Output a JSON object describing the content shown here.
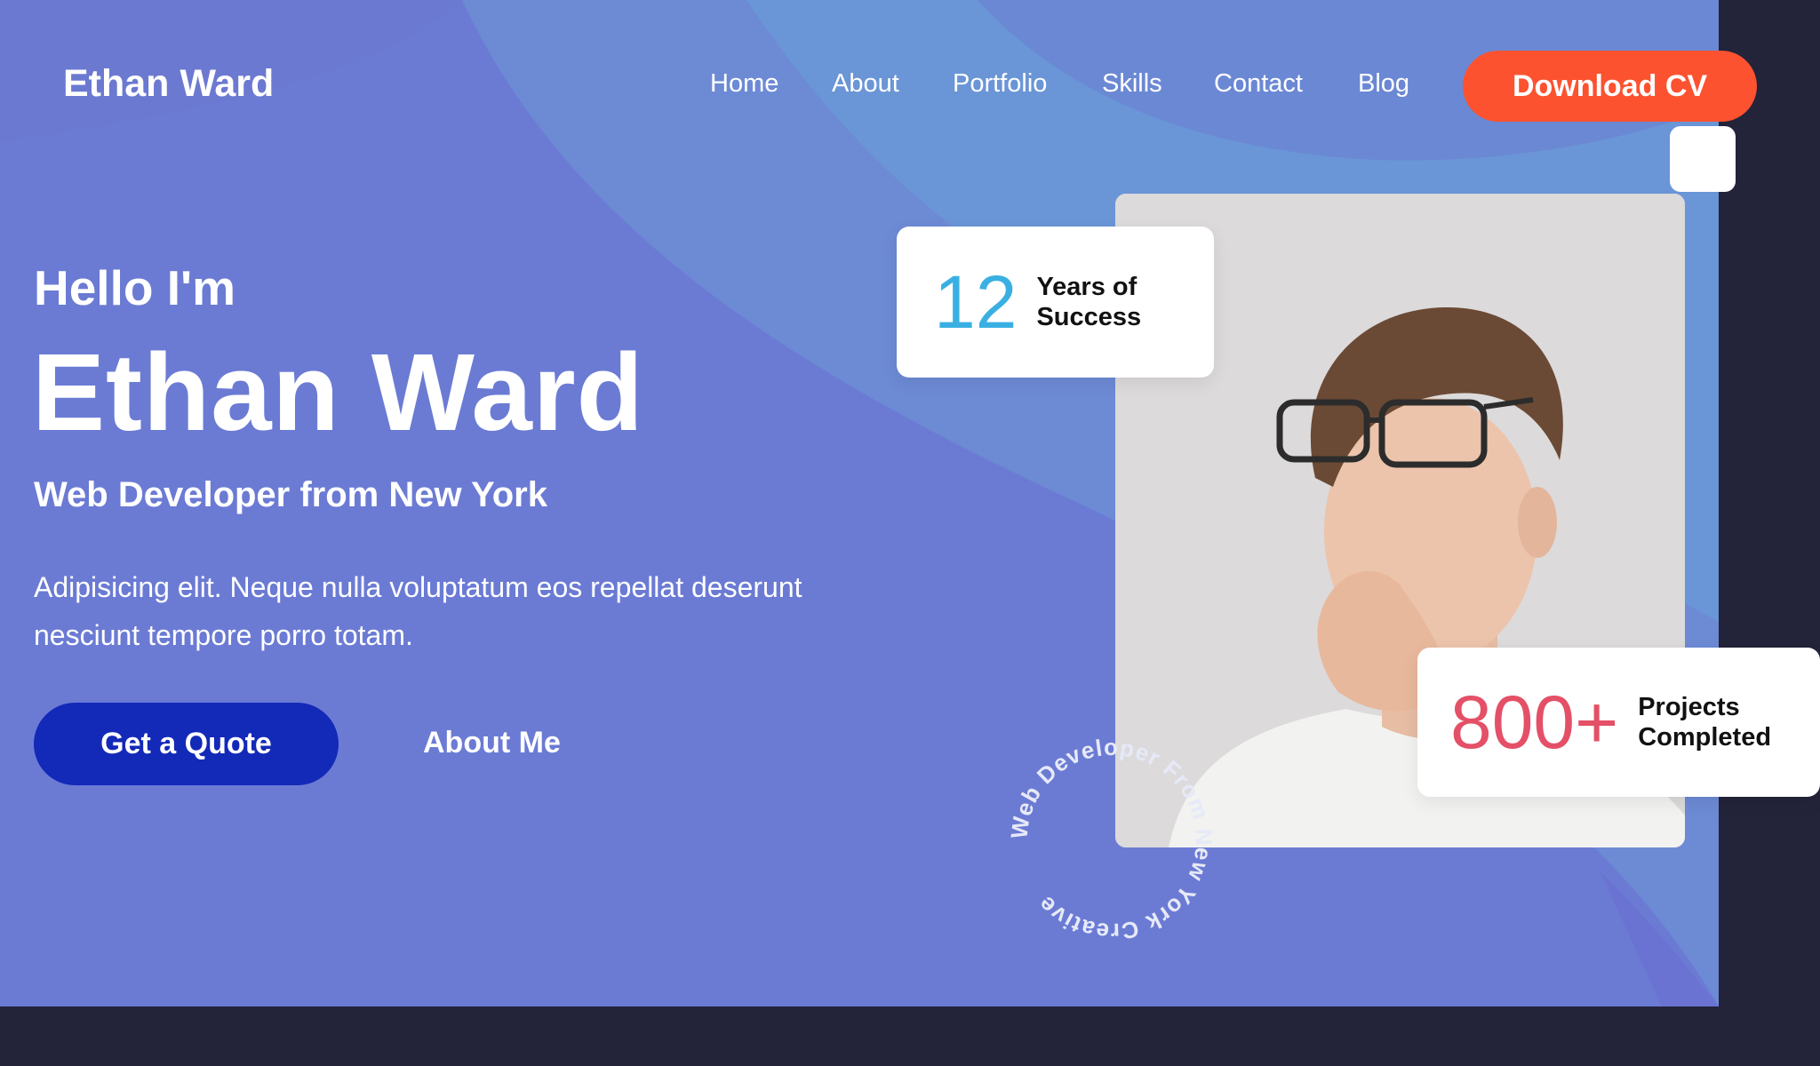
{
  "header": {
    "logo": "Ethan Ward",
    "nav": [
      {
        "label": "Home"
      },
      {
        "label": "About"
      },
      {
        "label": "Portfolio"
      },
      {
        "label": "Skills"
      },
      {
        "label": "Contact"
      },
      {
        "label": "Blog"
      }
    ],
    "cta_label": "Download CV"
  },
  "hero": {
    "greeting": "Hello I'm",
    "name": "Ethan Ward",
    "role": "Web Developer from New York",
    "description": "Adipisicing elit. Neque nulla voluptatum eos repellat deserunt nesciunt tempore porro totam.",
    "primary_button": "Get a Quote",
    "secondary_button": "About Me"
  },
  "stats": {
    "years": {
      "number": "12",
      "label_line1": "Years of",
      "label_line2": "Success"
    },
    "projects": {
      "number": "800+",
      "label_line1": "Projects",
      "label_line2": "Completed"
    }
  },
  "circular_badge": {
    "text": "Web Developer From New York Creative "
  },
  "colors": {
    "hero_background": "#6b7bd4",
    "page_background": "#23233a",
    "download_button": "#fc5230",
    "quote_button": "#1329b8",
    "years_number": "#3ab0e2",
    "projects_number": "#e45067"
  }
}
